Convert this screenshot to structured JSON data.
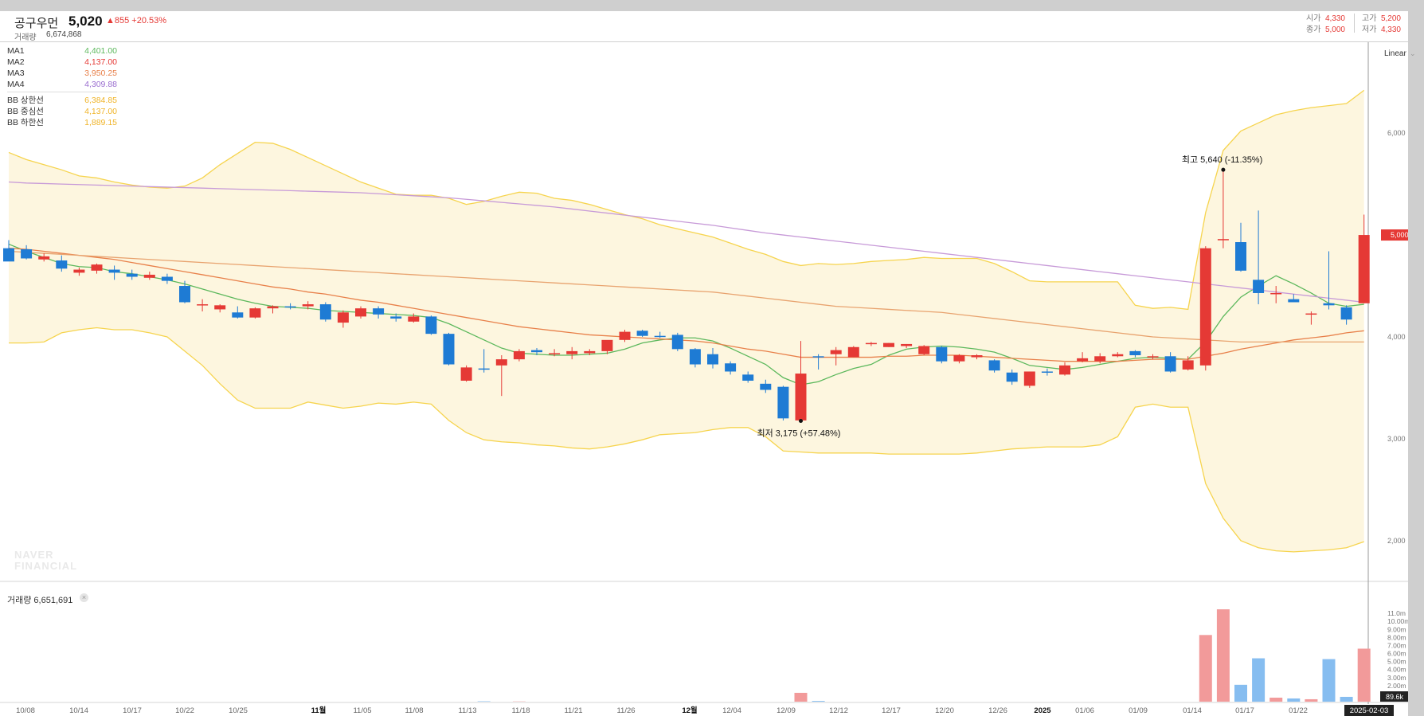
{
  "header": {
    "name": "공구우먼",
    "price": "5,020",
    "change": "▲855 +20.53%",
    "volume_label": "거래량",
    "volume_value": "6,674,868",
    "ohlc": [
      {
        "k": "시가",
        "v": "4,330"
      },
      {
        "k": "고가",
        "v": "5,200"
      },
      {
        "k": "종가",
        "v": "5,000"
      },
      {
        "k": "저가",
        "v": "4,330"
      }
    ]
  },
  "legend": {
    "ma": [
      {
        "label": "MA1",
        "value": "4,401.00",
        "color": "#5cb85c"
      },
      {
        "label": "MA2",
        "value": "4,137.00",
        "color": "#e53935"
      },
      {
        "label": "MA3",
        "value": "3,950.25",
        "color": "#e8804a"
      },
      {
        "label": "MA4",
        "value": "4,309.88",
        "color": "#9b6fd0"
      }
    ],
    "bb": [
      {
        "label": "BB 상한선",
        "value": "6,384.85",
        "color": "#f0b429"
      },
      {
        "label": "BB 중심선",
        "value": "4,137.00",
        "color": "#f0b429"
      },
      {
        "label": "BB 하한선",
        "value": "1,889.15",
        "color": "#f0b429"
      }
    ]
  },
  "toolbar": {
    "scale": "Linear"
  },
  "watermark": [
    "NAVER",
    "FINANCIAL"
  ],
  "volume_panel": {
    "label": "거래량 6,651,691",
    "close": "×"
  },
  "colors": {
    "up": "#e53935",
    "down": "#1e7bd4",
    "up_vol": "#f29a9a",
    "down_vol": "#86bdf0",
    "bb_fill": "#fdf6df",
    "bb_line": "#f6d44e"
  },
  "chart_data": {
    "type": "candlestick",
    "x_ticks": [
      "10/08",
      "10/14",
      "10/17",
      "10/22",
      "10/25",
      "11월",
      "11/05",
      "11/08",
      "11/13",
      "11/18",
      "11/21",
      "11/26",
      "12월",
      "12/04",
      "12/09",
      "12/12",
      "12/17",
      "12/20",
      "12/26",
      "2025",
      "01/06",
      "01/09",
      "01/14",
      "01/17",
      "01/22"
    ],
    "y_ticks": [
      "6,000",
      "5,000",
      "4,000",
      "3,000",
      "2,000"
    ],
    "ylim": [
      1600,
      6900
    ],
    "volume_ticks": [
      "11.0m",
      "10.00m",
      "9.00m",
      "8.00m",
      "7.00m",
      "6.00m",
      "5.00m",
      "4.00m",
      "3.00m",
      "2.00m",
      "1.00m"
    ],
    "volume_lim": [
      0,
      12000000
    ],
    "price_marker": "5,000",
    "volume_marker": "89.6k",
    "date_marker": "2025-02-03",
    "annotations": [
      {
        "text": "최고 5,640 (-11.35%)",
        "value": 5640,
        "index": 69
      },
      {
        "text": "최저 3,175 (+57.48%)",
        "value": 3175,
        "index": 45
      }
    ],
    "candles": [
      {
        "o": 4870,
        "h": 4950,
        "l": 4750,
        "c": 4740
      },
      {
        "o": 4860,
        "h": 4900,
        "l": 4760,
        "c": 4770
      },
      {
        "o": 4760,
        "h": 4820,
        "l": 4740,
        "c": 4790
      },
      {
        "o": 4750,
        "h": 4800,
        "l": 4640,
        "c": 4670
      },
      {
        "o": 4630,
        "h": 4680,
        "l": 4600,
        "c": 4660
      },
      {
        "o": 4650,
        "h": 4720,
        "l": 4620,
        "c": 4710
      },
      {
        "o": 4660,
        "h": 4700,
        "l": 4560,
        "c": 4630
      },
      {
        "o": 4620,
        "h": 4660,
        "l": 4560,
        "c": 4590
      },
      {
        "o": 4580,
        "h": 4640,
        "l": 4560,
        "c": 4610
      },
      {
        "o": 4590,
        "h": 4620,
        "l": 4520,
        "c": 4550
      },
      {
        "o": 4500,
        "h": 4550,
        "l": 4330,
        "c": 4340
      },
      {
        "o": 4320,
        "h": 4370,
        "l": 4250,
        "c": 4320
      },
      {
        "o": 4270,
        "h": 4320,
        "l": 4240,
        "c": 4310
      },
      {
        "o": 4240,
        "h": 4300,
        "l": 4180,
        "c": 4190
      },
      {
        "o": 4190,
        "h": 4290,
        "l": 4180,
        "c": 4280
      },
      {
        "o": 4280,
        "h": 4310,
        "l": 4230,
        "c": 4300
      },
      {
        "o": 4300,
        "h": 4330,
        "l": 4270,
        "c": 4290
      },
      {
        "o": 4300,
        "h": 4350,
        "l": 4270,
        "c": 4320
      },
      {
        "o": 4320,
        "h": 4340,
        "l": 4150,
        "c": 4170
      },
      {
        "o": 4140,
        "h": 4260,
        "l": 4090,
        "c": 4240
      },
      {
        "o": 4200,
        "h": 4300,
        "l": 4180,
        "c": 4280
      },
      {
        "o": 4280,
        "h": 4300,
        "l": 4180,
        "c": 4220
      },
      {
        "o": 4200,
        "h": 4230,
        "l": 4150,
        "c": 4180
      },
      {
        "o": 4150,
        "h": 4230,
        "l": 4140,
        "c": 4200
      },
      {
        "o": 4200,
        "h": 4210,
        "l": 4020,
        "c": 4030
      },
      {
        "o": 4030,
        "h": 4040,
        "l": 3720,
        "c": 3730
      },
      {
        "o": 3570,
        "h": 3720,
        "l": 3560,
        "c": 3700
      },
      {
        "o": 3690,
        "h": 3880,
        "l": 3650,
        "c": 3680
      },
      {
        "o": 3720,
        "h": 3820,
        "l": 3420,
        "c": 3780
      },
      {
        "o": 3780,
        "h": 3880,
        "l": 3760,
        "c": 3860
      },
      {
        "o": 3870,
        "h": 3890,
        "l": 3820,
        "c": 3850
      },
      {
        "o": 3840,
        "h": 3880,
        "l": 3810,
        "c": 3840
      },
      {
        "o": 3830,
        "h": 3900,
        "l": 3780,
        "c": 3860
      },
      {
        "o": 3840,
        "h": 3880,
        "l": 3820,
        "c": 3860
      },
      {
        "o": 3860,
        "h": 3930,
        "l": 3830,
        "c": 3970
      },
      {
        "o": 3970,
        "h": 4070,
        "l": 3950,
        "c": 4050
      },
      {
        "o": 4060,
        "h": 4070,
        "l": 4000,
        "c": 4010
      },
      {
        "o": 4010,
        "h": 4050,
        "l": 3990,
        "c": 4000
      },
      {
        "o": 4020,
        "h": 4040,
        "l": 3860,
        "c": 3880
      },
      {
        "o": 3880,
        "h": 3890,
        "l": 3700,
        "c": 3730
      },
      {
        "o": 3830,
        "h": 3890,
        "l": 3690,
        "c": 3730
      },
      {
        "o": 3740,
        "h": 3760,
        "l": 3630,
        "c": 3660
      },
      {
        "o": 3630,
        "h": 3660,
        "l": 3550,
        "c": 3570
      },
      {
        "o": 3540,
        "h": 3580,
        "l": 3450,
        "c": 3480
      },
      {
        "o": 3510,
        "h": 3520,
        "l": 3180,
        "c": 3200
      },
      {
        "o": 3180,
        "h": 3960,
        "l": 3175,
        "c": 3640
      },
      {
        "o": 3810,
        "h": 3830,
        "l": 3680,
        "c": 3800
      },
      {
        "o": 3830,
        "h": 3900,
        "l": 3720,
        "c": 3870
      },
      {
        "o": 3800,
        "h": 3910,
        "l": 3800,
        "c": 3900
      },
      {
        "o": 3930,
        "h": 3950,
        "l": 3910,
        "c": 3940
      },
      {
        "o": 3900,
        "h": 3940,
        "l": 3900,
        "c": 3940
      },
      {
        "o": 3910,
        "h": 3930,
        "l": 3890,
        "c": 3930
      },
      {
        "o": 3830,
        "h": 3920,
        "l": 3820,
        "c": 3910
      },
      {
        "o": 3900,
        "h": 3910,
        "l": 3740,
        "c": 3760
      },
      {
        "o": 3760,
        "h": 3830,
        "l": 3740,
        "c": 3820
      },
      {
        "o": 3800,
        "h": 3830,
        "l": 3780,
        "c": 3820
      },
      {
        "o": 3770,
        "h": 3780,
        "l": 3650,
        "c": 3670
      },
      {
        "o": 3650,
        "h": 3680,
        "l": 3530,
        "c": 3560
      },
      {
        "o": 3520,
        "h": 3660,
        "l": 3500,
        "c": 3660
      },
      {
        "o": 3660,
        "h": 3690,
        "l": 3620,
        "c": 3650
      },
      {
        "o": 3630,
        "h": 3750,
        "l": 3620,
        "c": 3720
      },
      {
        "o": 3760,
        "h": 3850,
        "l": 3750,
        "c": 3790
      },
      {
        "o": 3760,
        "h": 3840,
        "l": 3740,
        "c": 3810
      },
      {
        "o": 3810,
        "h": 3850,
        "l": 3800,
        "c": 3830
      },
      {
        "o": 3860,
        "h": 3870,
        "l": 3800,
        "c": 3820
      },
      {
        "o": 3810,
        "h": 3830,
        "l": 3780,
        "c": 3810
      },
      {
        "o": 3810,
        "h": 3850,
        "l": 3650,
        "c": 3660
      },
      {
        "o": 3680,
        "h": 3810,
        "l": 3670,
        "c": 3770
      },
      {
        "o": 3720,
        "h": 4890,
        "l": 3670,
        "c": 4870
      },
      {
        "o": 4960,
        "h": 5640,
        "l": 4870,
        "c": 4960
      },
      {
        "o": 4930,
        "h": 5120,
        "l": 4640,
        "c": 4650
      },
      {
        "o": 4560,
        "h": 5240,
        "l": 4320,
        "c": 4430
      },
      {
        "o": 4430,
        "h": 4500,
        "l": 4330,
        "c": 4430
      },
      {
        "o": 4370,
        "h": 4420,
        "l": 4350,
        "c": 4340
      },
      {
        "o": 4220,
        "h": 4250,
        "l": 4120,
        "c": 4230
      },
      {
        "o": 4330,
        "h": 4840,
        "l": 4270,
        "c": 4310
      },
      {
        "o": 4290,
        "h": 4310,
        "l": 4120,
        "c": 4170
      },
      {
        "o": 4330,
        "h": 5200,
        "l": 4330,
        "c": 5000
      }
    ],
    "series": [
      {
        "name": "MA1",
        "color": "#5cb85c",
        "values": [
          4910,
          4840,
          4780,
          4720,
          4690,
          4680,
          4640,
          4620,
          4590,
          4560,
          4520,
          4470,
          4420,
          4370,
          4330,
          4300,
          4290,
          4280,
          4260,
          4250,
          4240,
          4230,
          4220,
          4210,
          4190,
          4130,
          4050,
          3970,
          3890,
          3840,
          3830,
          3820,
          3820,
          3830,
          3840,
          3880,
          3940,
          3970,
          3990,
          3990,
          3960,
          3890,
          3810,
          3730,
          3600,
          3530,
          3560,
          3630,
          3690,
          3730,
          3820,
          3880,
          3900,
          3910,
          3900,
          3880,
          3850,
          3790,
          3720,
          3700,
          3680,
          3700,
          3730,
          3760,
          3790,
          3800,
          3790,
          3780,
          3950,
          4200,
          4390,
          4500,
          4600,
          4520,
          4430,
          4330,
          4300,
          4320
        ]
      },
      {
        "name": "MA2",
        "color": "#e8804a",
        "values": [
          4870,
          4860,
          4840,
          4820,
          4800,
          4780,
          4760,
          4730,
          4700,
          4670,
          4640,
          4610,
          4580,
          4550,
          4520,
          4490,
          4470,
          4440,
          4420,
          4390,
          4360,
          4340,
          4310,
          4280,
          4250,
          4220,
          4190,
          4160,
          4130,
          4100,
          4080,
          4060,
          4040,
          4020,
          4010,
          4000,
          3990,
          3980,
          3970,
          3960,
          3940,
          3910,
          3880,
          3860,
          3830,
          3800,
          3800,
          3800,
          3800,
          3800,
          3810,
          3810,
          3820,
          3820,
          3820,
          3810,
          3800,
          3790,
          3780,
          3770,
          3760,
          3760,
          3760,
          3760,
          3770,
          3780,
          3780,
          3780,
          3810,
          3840,
          3880,
          3910,
          3940,
          3970,
          3990,
          4010,
          4040,
          4060
        ]
      },
      {
        "name": "MA3",
        "color": "#e8a36f",
        "values": [
          4840,
          4830,
          4820,
          4810,
          4800,
          4790,
          4780,
          4770,
          4760,
          4750,
          4740,
          4730,
          4720,
          4710,
          4700,
          4690,
          4680,
          4670,
          4660,
          4650,
          4640,
          4630,
          4620,
          4610,
          4600,
          4590,
          4580,
          4570,
          4560,
          4550,
          4540,
          4530,
          4520,
          4510,
          4500,
          4490,
          4480,
          4470,
          4460,
          4450,
          4440,
          4420,
          4400,
          4380,
          4360,
          4340,
          4320,
          4300,
          4290,
          4280,
          4270,
          4260,
          4250,
          4240,
          4220,
          4200,
          4180,
          4160,
          4140,
          4120,
          4100,
          4080,
          4060,
          4040,
          4020,
          4000,
          3990,
          3980,
          3970,
          3960,
          3950,
          3950,
          3950,
          3950,
          3950,
          3950,
          3950,
          3950
        ]
      },
      {
        "name": "MA4",
        "color": "#c79ad8",
        "values": [
          5520,
          5510,
          5505,
          5500,
          5495,
          5490,
          5485,
          5480,
          5475,
          5470,
          5465,
          5460,
          5455,
          5450,
          5445,
          5440,
          5435,
          5430,
          5425,
          5420,
          5415,
          5405,
          5395,
          5385,
          5375,
          5365,
          5350,
          5335,
          5320,
          5305,
          5290,
          5275,
          5255,
          5235,
          5215,
          5195,
          5175,
          5155,
          5135,
          5115,
          5095,
          5070,
          5045,
          5020,
          5000,
          4980,
          4960,
          4940,
          4920,
          4900,
          4880,
          4860,
          4840,
          4820,
          4800,
          4780,
          4760,
          4740,
          4720,
          4700,
          4680,
          4660,
          4640,
          4620,
          4600,
          4580,
          4560,
          4540,
          4520,
          4500,
          4480,
          4460,
          4440,
          4420,
          4400,
          4380,
          4360,
          4340
        ]
      }
    ],
    "bb_upper": [
      5810,
      5740,
      5690,
      5640,
      5580,
      5560,
      5520,
      5490,
      5470,
      5460,
      5480,
      5560,
      5690,
      5800,
      5910,
      5900,
      5840,
      5760,
      5680,
      5600,
      5520,
      5460,
      5400,
      5390,
      5390,
      5360,
      5300,
      5330,
      5380,
      5420,
      5410,
      5360,
      5340,
      5300,
      5250,
      5200,
      5160,
      5100,
      5060,
      5020,
      4980,
      4920,
      4860,
      4810,
      4740,
      4700,
      4720,
      4710,
      4720,
      4740,
      4750,
      4760,
      4780,
      4770,
      4770,
      4770,
      4720,
      4640,
      4550,
      4540,
      4540,
      4540,
      4540,
      4540,
      4310,
      4280,
      4290,
      4270,
      5220,
      5830,
      6020,
      6100,
      6180,
      6220,
      6250,
      6270,
      6290,
      6420
    ],
    "bb_lower": [
      3940,
      3940,
      3950,
      4040,
      4070,
      4090,
      4070,
      4070,
      4040,
      4000,
      3860,
      3720,
      3540,
      3380,
      3300,
      3300,
      3300,
      3360,
      3330,
      3300,
      3320,
      3350,
      3340,
      3360,
      3340,
      3180,
      3060,
      2990,
      2970,
      2960,
      2940,
      2930,
      2910,
      2900,
      2920,
      2950,
      2990,
      3040,
      3050,
      3060,
      3090,
      3110,
      3110,
      3020,
      2880,
      2870,
      2860,
      2860,
      2860,
      2860,
      2850,
      2850,
      2850,
      2850,
      2850,
      2860,
      2880,
      2900,
      2910,
      2920,
      2920,
      2920,
      2940,
      3020,
      3310,
      3340,
      3310,
      3310,
      2560,
      2220,
      2000,
      1930,
      1900,
      1890,
      1900,
      1910,
      1930,
      1990
    ],
    "volumes": [
      0,
      0,
      0,
      0,
      0,
      0,
      0,
      0,
      0,
      0,
      0,
      0,
      0,
      0,
      0,
      0,
      0,
      0,
      0,
      0,
      0,
      0,
      0,
      0,
      0,
      0,
      0,
      50000,
      0,
      30000,
      0,
      0,
      0,
      0,
      0,
      0,
      0,
      0,
      0,
      0,
      0,
      0,
      0,
      0,
      0,
      1100000,
      90000,
      0,
      0,
      0,
      0,
      0,
      0,
      0,
      0,
      0,
      0,
      0,
      0,
      0,
      0,
      0,
      0,
      0,
      0,
      0,
      0,
      0,
      8300000,
      11500000,
      2100000,
      5400000,
      500000,
      400000,
      300000,
      5300000,
      600000,
      6600000
    ]
  }
}
